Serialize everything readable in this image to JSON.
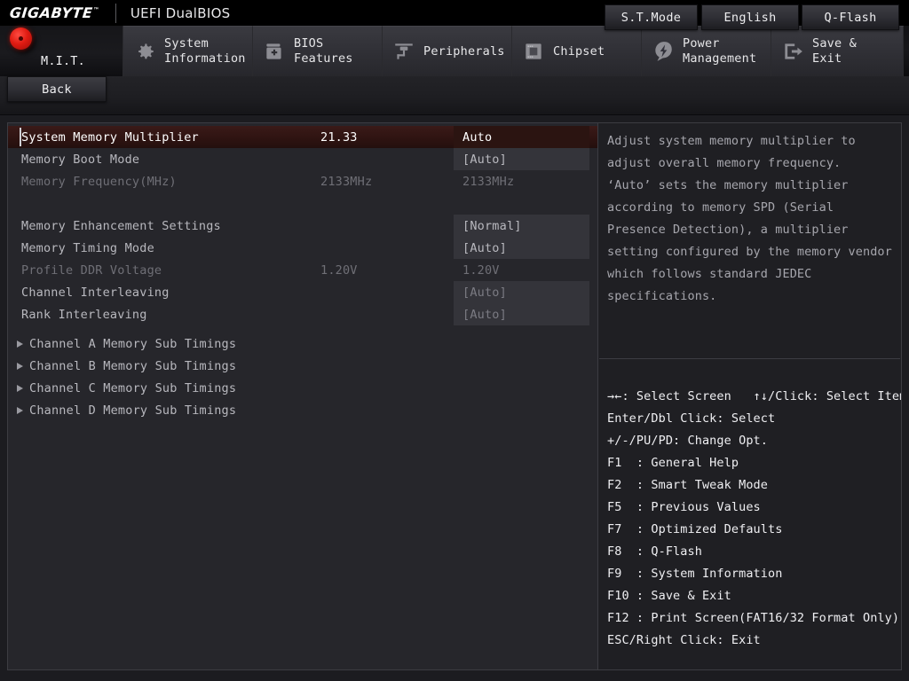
{
  "brand": {
    "logo": "GIGABYTE",
    "logo_tm": "™",
    "subtitle": "UEFI DualBIOS"
  },
  "tabs": [
    {
      "id": "mit",
      "label": "M.I.T.",
      "icon": "red-target-icon",
      "active": true
    },
    {
      "id": "system-info",
      "label": "System\nInformation",
      "icon": "gear-icon",
      "active": false
    },
    {
      "id": "bios-features",
      "label": "BIOS\nFeatures",
      "icon": "folder-plus-icon",
      "active": false
    },
    {
      "id": "peripherals",
      "label": "Peripherals",
      "icon": "peripheral-icon",
      "active": false
    },
    {
      "id": "chipset",
      "label": "Chipset",
      "icon": "chip-icon",
      "active": false
    },
    {
      "id": "power-mgmt",
      "label": "Power\nManagement",
      "icon": "lightning-icon",
      "active": false
    },
    {
      "id": "save-exit",
      "label": "Save & Exit",
      "icon": "exit-arrow-icon",
      "active": false
    }
  ],
  "toolbar": {
    "back_label": "Back",
    "stmode_label": "S.T.Mode",
    "english_label": "English",
    "qflash_label": "Q-Flash"
  },
  "settings": [
    {
      "name": "System Memory Multiplier",
      "middle": "21.33",
      "value": "Auto",
      "state": "highlight",
      "boxed": true
    },
    {
      "name": "Memory Boot Mode",
      "middle": "",
      "value": "[Auto]",
      "state": "normal",
      "boxed": true
    },
    {
      "name": "Memory Frequency(MHz)",
      "middle": "2133MHz",
      "value": "2133MHz",
      "state": "dim",
      "boxed": false
    },
    {
      "name": "",
      "middle": "",
      "value": "",
      "state": "spacer",
      "boxed": false
    },
    {
      "name": "Memory Enhancement Settings",
      "middle": "",
      "value": "[Normal]",
      "state": "normal",
      "boxed": true
    },
    {
      "name": "Memory Timing Mode",
      "middle": "",
      "value": "[Auto]",
      "state": "normal",
      "boxed": true
    },
    {
      "name": "Profile DDR Voltage",
      "middle": "1.20V",
      "value": "1.20V",
      "state": "dim",
      "boxed": false
    },
    {
      "name": "Channel Interleaving",
      "middle": "",
      "value": "[Auto]",
      "state": "dimbox",
      "boxed": true
    },
    {
      "name": "Rank Interleaving",
      "middle": "",
      "value": "[Auto]",
      "state": "dimbox",
      "boxed": true
    }
  ],
  "submenus": [
    {
      "label": "Channel A Memory Sub Timings",
      "icon": "triangle-right-icon"
    },
    {
      "label": "Channel B Memory Sub Timings",
      "icon": "triangle-right-icon"
    },
    {
      "label": "Channel C Memory Sub Timings",
      "icon": "triangle-right-icon"
    },
    {
      "label": "Channel D Memory Sub Timings",
      "icon": "triangle-right-icon"
    }
  ],
  "help": {
    "lines": [
      "Adjust system memory multiplier to",
      "adjust overall memory frequency.",
      "‘Auto’ sets the memory multiplier",
      "according to memory SPD (Serial",
      "Presence Detection), a multiplier",
      "setting configured by the memory vendor",
      "which follows standard JEDEC",
      "specifications."
    ]
  },
  "shortcuts": {
    "lines": [
      "→←: Select Screen   ↑↓/Click: Select Item",
      "Enter/Dbl Click: Select",
      "+/-/PU/PD: Change Opt.",
      "F1  : General Help",
      "F2  : Smart Tweak Mode",
      "F5  : Previous Values",
      "F7  : Optimized Defaults",
      "F8  : Q-Flash",
      "F9  : System Information",
      "F10 : Save & Exit",
      "F12 : Print Screen(FAT16/32 Format Only)",
      "ESC/Right Click: Exit"
    ]
  },
  "colors": {
    "highlight_row": "#2e1311",
    "accent_red": "#e01b12",
    "panel_bg": "#26262b",
    "value_box": "#34343a",
    "text": "#b8b8be"
  }
}
